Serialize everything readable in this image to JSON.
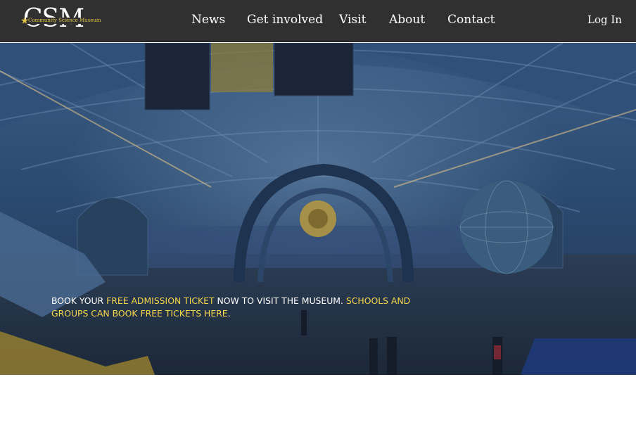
{
  "header": {
    "logo": {
      "letters": "CSM",
      "tagline": "Community Science Museum",
      "star_icon": "star-icon",
      "accent_color": "#e2c049"
    },
    "nav": [
      {
        "label": "News"
      },
      {
        "label": "Get involved"
      },
      {
        "label": "Visit"
      },
      {
        "label": "About"
      },
      {
        "label": "Contact"
      }
    ],
    "login_label": "Log In",
    "background_color": "#2f302f"
  },
  "hero": {
    "image": "science-museum-hall-photo",
    "message": {
      "part1": "Book your ",
      "link1": "free admission ticket",
      "part2": " now to visit the museum. ",
      "link2": "Schools and groups can book free tickets here",
      "part3": "."
    },
    "highlight_color": "#f2d64d"
  }
}
